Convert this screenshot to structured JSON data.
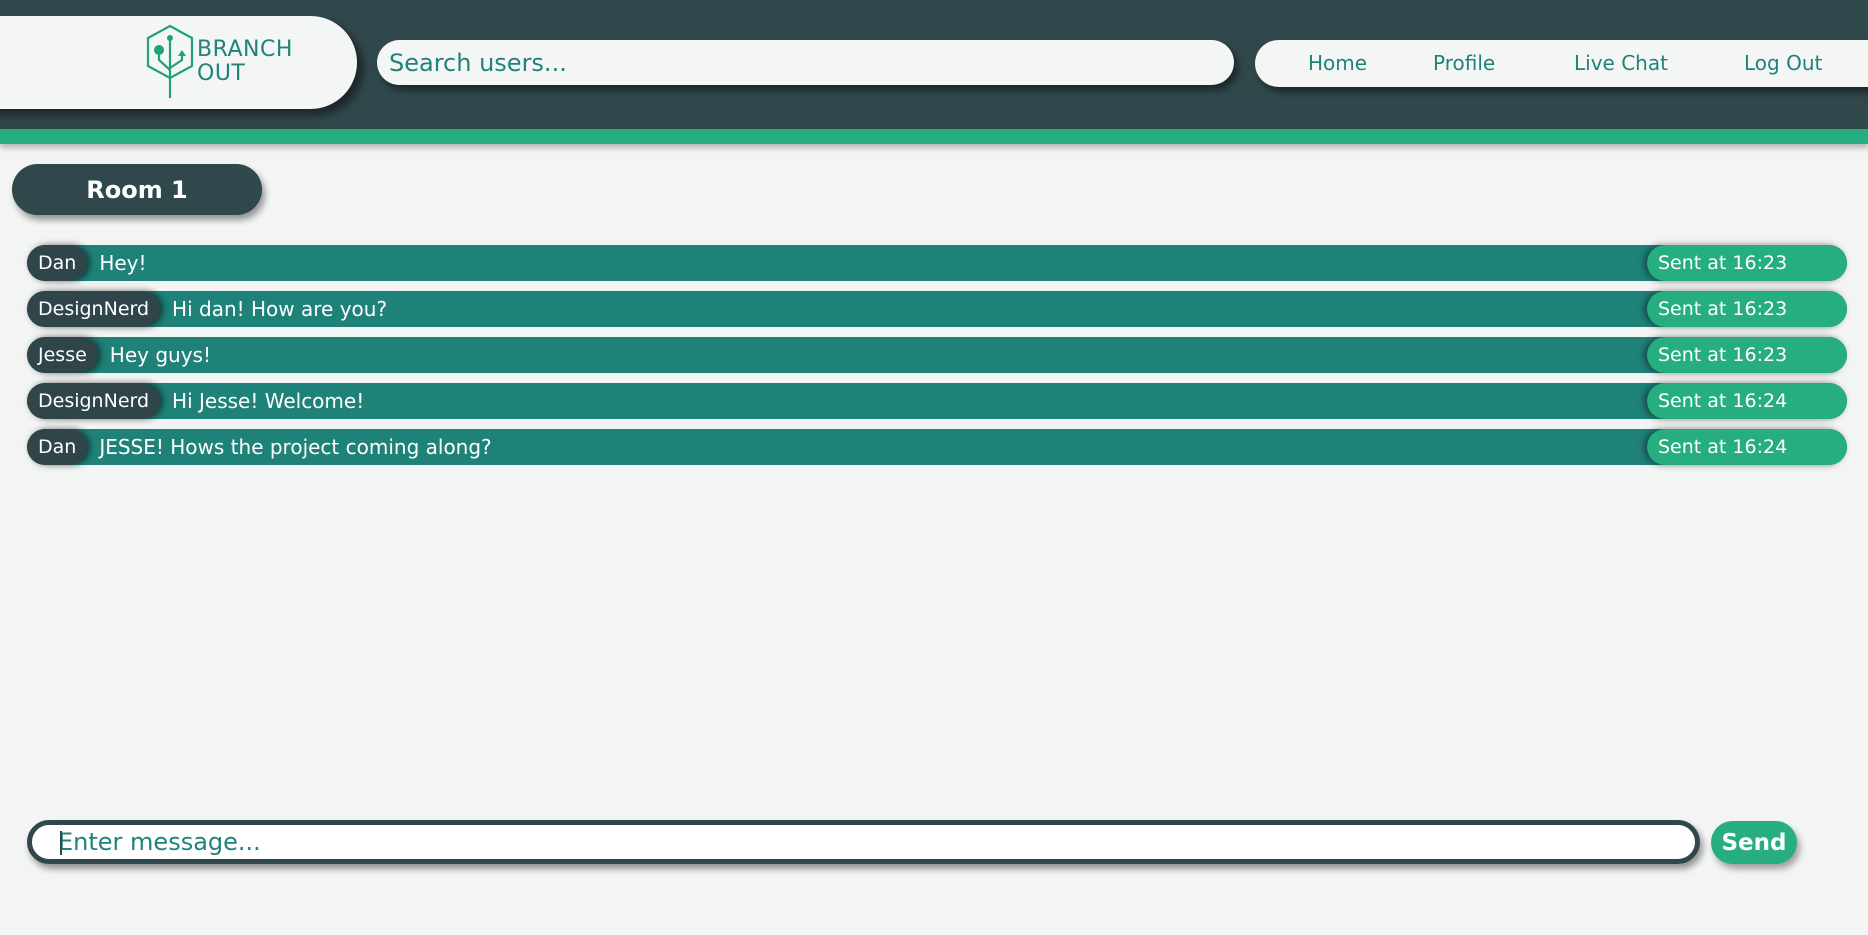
{
  "brand": {
    "line1": "BRANCH",
    "line2": "OUT"
  },
  "search": {
    "placeholder": "Search users..."
  },
  "nav": {
    "home": "Home",
    "profile": "Profile",
    "live_chat": "Live Chat",
    "log_out": "Log Out"
  },
  "room": {
    "title": "Room 1"
  },
  "messages": [
    {
      "user": "Dan",
      "text": "Hey!",
      "time": "Sent at 16:23"
    },
    {
      "user": "DesignNerd",
      "text": "Hi dan! How are you?",
      "time": "Sent at 16:23"
    },
    {
      "user": "Jesse",
      "text": "Hey guys!",
      "time": "Sent at 16:23"
    },
    {
      "user": "DesignNerd",
      "text": "Hi Jesse! Welcome!",
      "time": "Sent at 16:24"
    },
    {
      "user": "Dan",
      "text": "JESSE! Hows the project coming along?",
      "time": "Sent at 16:24"
    }
  ],
  "composer": {
    "placeholder": "Enter message...",
    "send_label": "Send"
  },
  "colors": {
    "header_bg": "#30474b",
    "accent_green": "#26ad80",
    "message_teal": "#1f8278",
    "text_teal": "#20837a",
    "page_bg": "#f3f5f4"
  }
}
